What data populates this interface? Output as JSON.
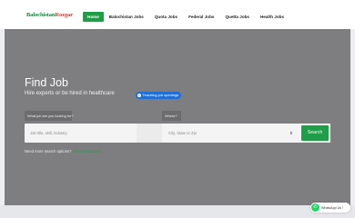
{
  "site": {
    "logo_part1": "Balochistan",
    "logo_part2": "Rozgar"
  },
  "nav": {
    "items": [
      {
        "label": "Home",
        "active": true
      },
      {
        "label": "Balochistan Jobs"
      },
      {
        "label": "Quota Jobs"
      },
      {
        "label": "Federal Jobs"
      },
      {
        "label": "Quetta Jobs"
      },
      {
        "label": "Health Jobs"
      }
    ]
  },
  "hero": {
    "title": "Find Job",
    "subtitle": "Hire experts or be hired in healthcare",
    "badge": "Teaching job openings"
  },
  "search": {
    "tag_what": "What job are you looking for?",
    "tag_where": "Where?",
    "what_placeholder": "Job title, skill, industry",
    "where_placeholder": "City, State or Zip",
    "button": "Search"
  },
  "help": {
    "text": "Need more search options?",
    "link": "Advanced search"
  },
  "whatsapp": {
    "label": "WhatsApp Us !"
  },
  "colors": {
    "brand_green": "#1f9d48",
    "logo_red": "#d6362d",
    "badge_blue": "#1e6fd6",
    "hero_gray": "#7e7e80"
  }
}
